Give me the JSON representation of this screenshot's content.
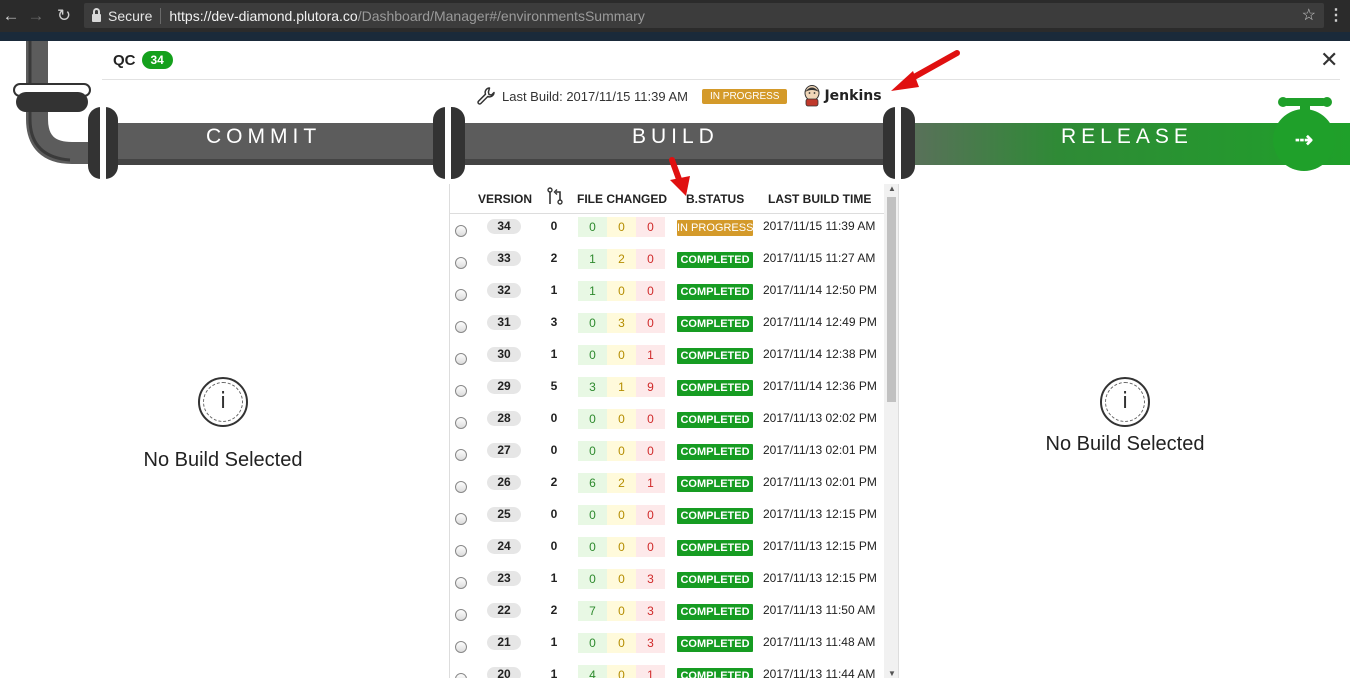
{
  "browser": {
    "secure_label": "Secure",
    "url_host": "https://dev-diamond.plutora.co",
    "url_path": "/Dashboard/Manager#/environmentsSummary"
  },
  "environment": {
    "name": "QC",
    "count": "34"
  },
  "last_build": {
    "label": "Last Build: 2017/11/15 11:39 AM",
    "status": "IN PROGRESS",
    "tool": "Jenkins"
  },
  "stages": {
    "commit": "COMMIT",
    "build": "BUILD",
    "release": "RELEASE"
  },
  "left_panel": {
    "message": "No Build Selected",
    "icon": "info-icon"
  },
  "right_panel": {
    "message": "No Build Selected",
    "icon": "info-icon"
  },
  "table": {
    "headers": {
      "version": "VERSION",
      "merges_icon": "git-merge-icon",
      "files": "FILE CHANGED",
      "status": "B.STATUS",
      "time": "LAST BUILD TIME"
    },
    "rows": [
      {
        "version": "34",
        "merges": "0",
        "added": "0",
        "modified": "0",
        "deleted": "0",
        "status": "IN PROGRESS",
        "state": "inprogress",
        "time": "2017/11/15 11:39 AM"
      },
      {
        "version": "33",
        "merges": "2",
        "added": "1",
        "modified": "2",
        "deleted": "0",
        "status": "COMPLETED",
        "state": "completed",
        "time": "2017/11/15 11:27 AM"
      },
      {
        "version": "32",
        "merges": "1",
        "added": "1",
        "modified": "0",
        "deleted": "0",
        "status": "COMPLETED",
        "state": "completed",
        "time": "2017/11/14 12:50 PM"
      },
      {
        "version": "31",
        "merges": "3",
        "added": "0",
        "modified": "3",
        "deleted": "0",
        "status": "COMPLETED",
        "state": "completed",
        "time": "2017/11/14 12:49 PM"
      },
      {
        "version": "30",
        "merges": "1",
        "added": "0",
        "modified": "0",
        "deleted": "1",
        "status": "COMPLETED",
        "state": "completed",
        "time": "2017/11/14 12:38 PM"
      },
      {
        "version": "29",
        "merges": "5",
        "added": "3",
        "modified": "1",
        "deleted": "9",
        "status": "COMPLETED",
        "state": "completed",
        "time": "2017/11/14 12:36 PM"
      },
      {
        "version": "28",
        "merges": "0",
        "added": "0",
        "modified": "0",
        "deleted": "0",
        "status": "COMPLETED",
        "state": "completed",
        "time": "2017/11/13 02:02 PM"
      },
      {
        "version": "27",
        "merges": "0",
        "added": "0",
        "modified": "0",
        "deleted": "0",
        "status": "COMPLETED",
        "state": "completed",
        "time": "2017/11/13 02:01 PM"
      },
      {
        "version": "26",
        "merges": "2",
        "added": "6",
        "modified": "2",
        "deleted": "1",
        "status": "COMPLETED",
        "state": "completed",
        "time": "2017/11/13 02:01 PM"
      },
      {
        "version": "25",
        "merges": "0",
        "added": "0",
        "modified": "0",
        "deleted": "0",
        "status": "COMPLETED",
        "state": "completed",
        "time": "2017/11/13 12:15 PM"
      },
      {
        "version": "24",
        "merges": "0",
        "added": "0",
        "modified": "0",
        "deleted": "0",
        "status": "COMPLETED",
        "state": "completed",
        "time": "2017/11/13 12:15 PM"
      },
      {
        "version": "23",
        "merges": "1",
        "added": "0",
        "modified": "0",
        "deleted": "3",
        "status": "COMPLETED",
        "state": "completed",
        "time": "2017/11/13 12:15 PM"
      },
      {
        "version": "22",
        "merges": "2",
        "added": "7",
        "modified": "0",
        "deleted": "3",
        "status": "COMPLETED",
        "state": "completed",
        "time": "2017/11/13 11:50 AM"
      },
      {
        "version": "21",
        "merges": "1",
        "added": "0",
        "modified": "0",
        "deleted": "3",
        "status": "COMPLETED",
        "state": "completed",
        "time": "2017/11/13 11:48 AM"
      },
      {
        "version": "20",
        "merges": "1",
        "added": "4",
        "modified": "0",
        "deleted": "1",
        "status": "COMPLETED",
        "state": "completed",
        "time": "2017/11/13 11:44 AM"
      }
    ]
  },
  "colors": {
    "pipe_gray": "#5c5c5c",
    "release_green": "#1fa02a",
    "completed": "#169c22",
    "in_progress": "#d49a2a",
    "annotation_red": "#e01010"
  }
}
